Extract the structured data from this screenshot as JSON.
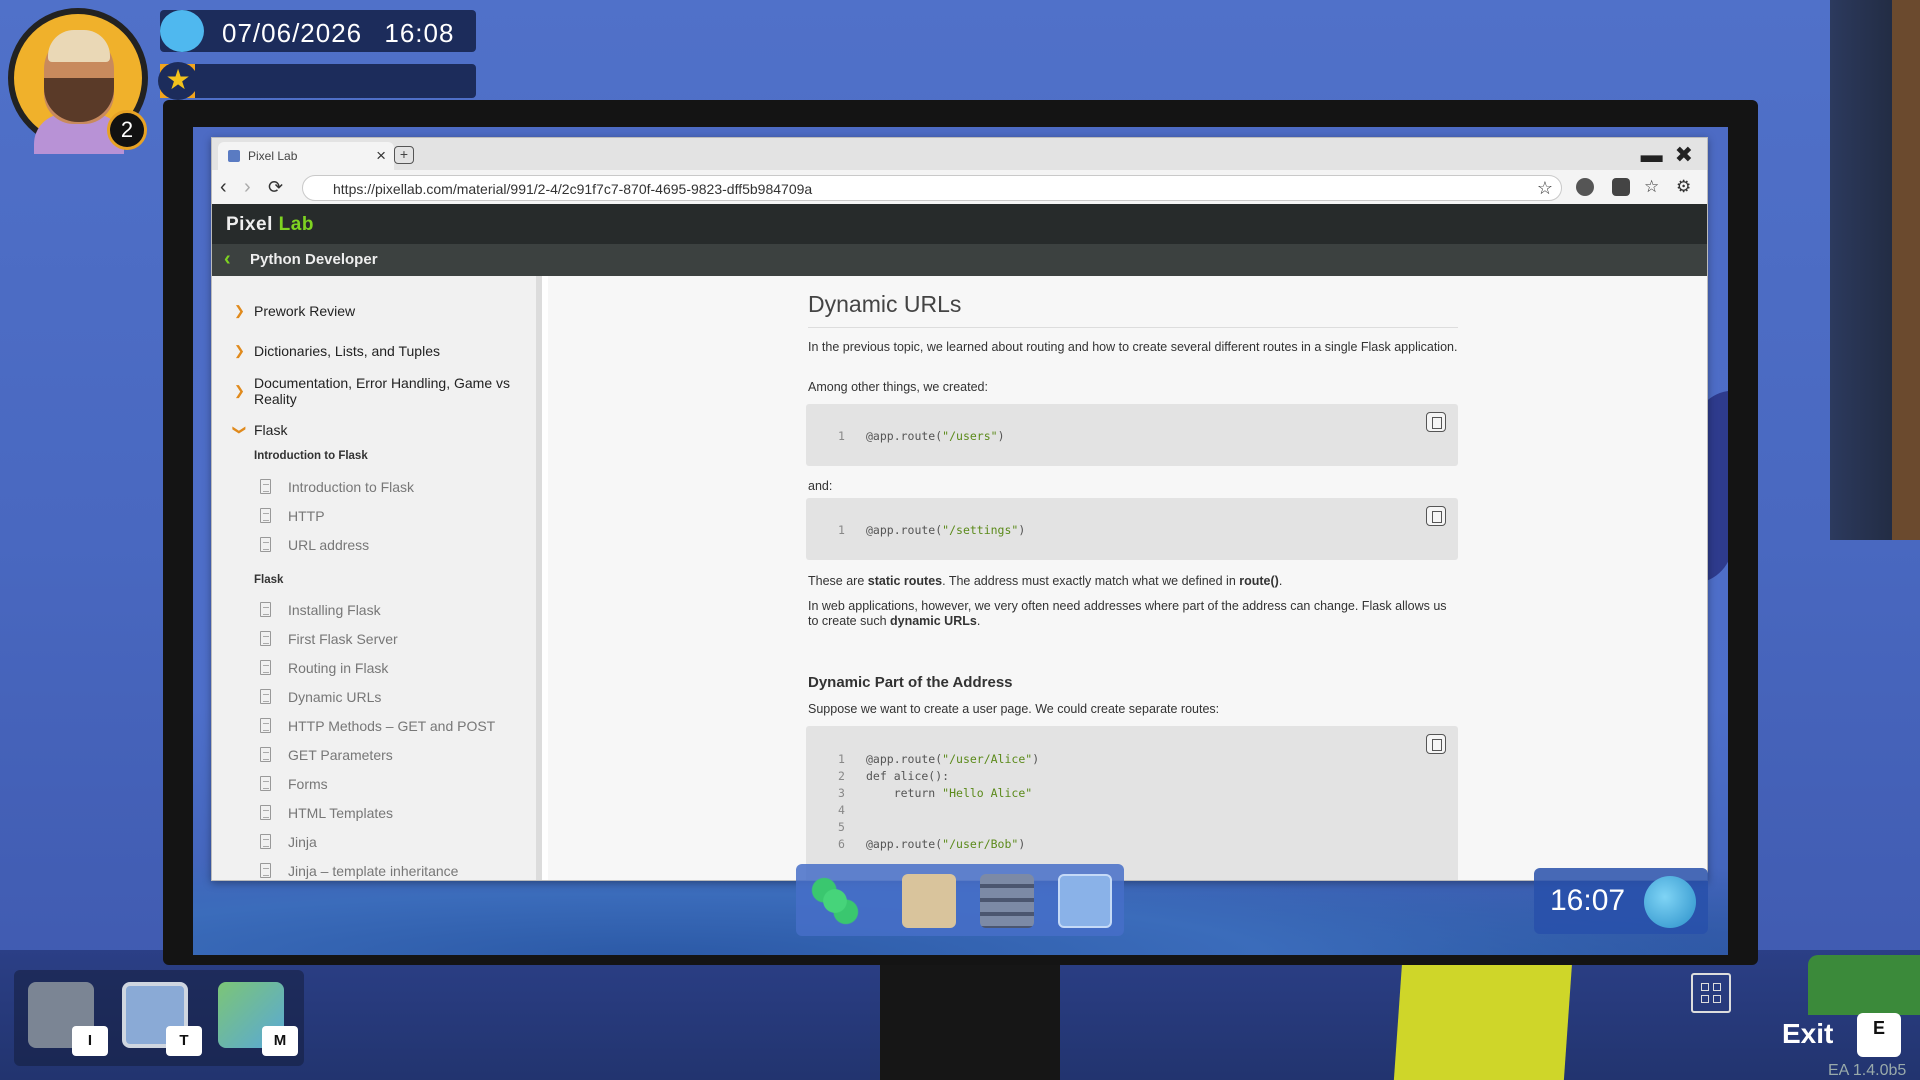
{
  "hud": {
    "date": "07/06/2026",
    "time": "16:08",
    "level": "2",
    "xp_progress": 0.11
  },
  "browser": {
    "tab_title": "Pixel Lab",
    "url": "https://pixellab.com/material/991/2-4/2c91f7c7-870f-4695-9823-dff5b984709a"
  },
  "site": {
    "brand_main": "Pixel",
    "brand_accent": "Lab",
    "course": "Python Developer"
  },
  "sidebar": {
    "sections": [
      {
        "label": "Prework Review"
      },
      {
        "label": "Dictionaries, Lists, and Tuples"
      },
      {
        "label": "Documentation, Error Handling, Game vs Reality"
      },
      {
        "label": "Flask"
      }
    ],
    "groups": [
      {
        "title": "Introduction to Flask",
        "lessons": [
          "Introduction to Flask",
          "HTTP",
          "URL address"
        ]
      },
      {
        "title": "Flask",
        "lessons": [
          "Installing Flask",
          "First Flask Server",
          "Routing in Flask",
          "Dynamic URLs",
          "HTTP Methods – GET and POST",
          "GET Parameters",
          "Forms",
          "HTML Templates",
          "Jinja",
          "Jinja – template inheritance"
        ]
      }
    ]
  },
  "article": {
    "title": "Dynamic URLs",
    "p1": "In the previous topic, we learned about routing and how to create several different routes in a single Flask application.",
    "p2": "Among other things, we created:",
    "code1": {
      "num": "1",
      "pre": "@app.route(",
      "str": "\"/users\"",
      "post": ")"
    },
    "p3": "and:",
    "code2": {
      "num": "1",
      "pre": "@app.route(",
      "str": "\"/settings\"",
      "post": ")"
    },
    "p4": {
      "a": "These are ",
      "b": "static routes",
      "c": ". The address must exactly match what we defined in ",
      "d": "route()",
      "e": "."
    },
    "p5": {
      "a": "In web applications, however, we very often need addresses where part of the address can change. Flask allows us to create such ",
      "b": "dynamic URLs",
      "c": "."
    },
    "h2": "Dynamic Part of the Address",
    "p6": "Suppose we want to create a user page. We could create separate routes:",
    "code3": [
      {
        "num": "1",
        "pre": "@app.route(",
        "str": "\"/user/Alice\"",
        "post": ")"
      },
      {
        "num": "2",
        "pre": "def alice():",
        "str": "",
        "post": ""
      },
      {
        "num": "3",
        "pre": "    return ",
        "str": "\"Hello Alice\"",
        "post": ""
      },
      {
        "num": "4",
        "pre": "",
        "str": "",
        "post": ""
      },
      {
        "num": "5",
        "pre": "",
        "str": "",
        "post": ""
      },
      {
        "num": "6",
        "pre": "@app.route(",
        "str": "\"/user/Bob\"",
        "post": ")"
      }
    ]
  },
  "taskbar": {
    "clock": "16:07"
  },
  "bottom_keys": {
    "inventory": "I",
    "tablet": "T",
    "map": "M"
  },
  "exit": {
    "label": "Exit",
    "key": "E"
  },
  "version": "EA 1.4.0b5"
}
